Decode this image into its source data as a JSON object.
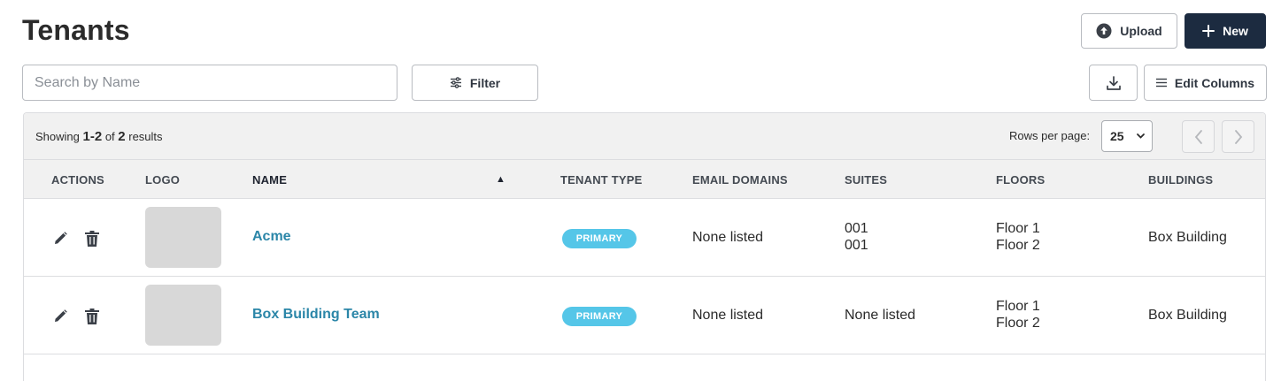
{
  "header": {
    "title": "Tenants",
    "upload_label": "Upload",
    "new_label": "New"
  },
  "toolbar": {
    "search_placeholder": "Search by Name",
    "filter_label": "Filter",
    "edit_columns_label": "Edit Columns"
  },
  "results": {
    "showing_prefix": "Showing",
    "range": "1-2",
    "of": "of",
    "total": "2",
    "suffix": "results",
    "rows_per_page_label": "Rows per page:",
    "rows_per_page_value": "25"
  },
  "table": {
    "columns": [
      "ACTIONS",
      "LOGO",
      "NAME",
      "TENANT TYPE",
      "EMAIL DOMAINS",
      "SUITES",
      "FLOORS",
      "BUILDINGS"
    ],
    "sort": {
      "column": "NAME",
      "direction": "asc",
      "indicator": "▲"
    },
    "rows": [
      {
        "name": "Acme",
        "tenant_type": "PRIMARY",
        "email_domains": "None listed",
        "suites": [
          "001",
          "001"
        ],
        "floors": [
          "Floor 1",
          "Floor 2"
        ],
        "buildings": "Box Building"
      },
      {
        "name": "Box Building Team",
        "tenant_type": "PRIMARY",
        "email_domains": "None listed",
        "suites": [
          "None listed"
        ],
        "floors": [
          "Floor 1",
          "Floor 2"
        ],
        "buildings": "Box Building"
      }
    ]
  },
  "colors": {
    "primary_button": "#1c2b40",
    "link": "#2b86a8",
    "badge": "#55c6e8"
  },
  "icons": {
    "upload": "upload-circle-icon",
    "new": "plus-icon",
    "filter": "sliders-icon",
    "download": "download-icon",
    "edit_columns": "menu-lines-icon",
    "edit": "pencil-icon",
    "delete": "trash-icon"
  }
}
